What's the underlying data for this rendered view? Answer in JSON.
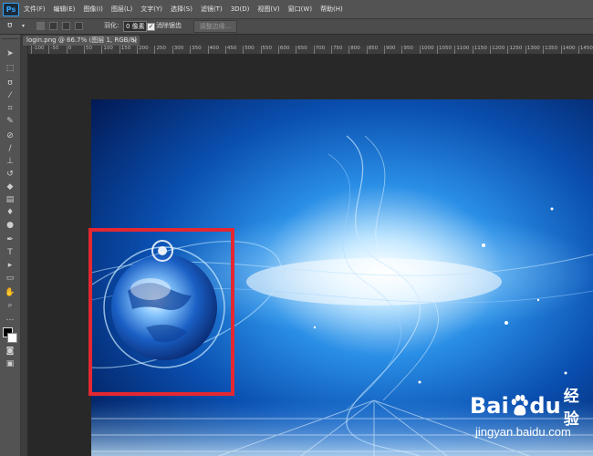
{
  "app": {
    "logo": "Ps",
    "menu": [
      "文件(F)",
      "编辑(E)",
      "图像(I)",
      "图层(L)",
      "文字(Y)",
      "选择(S)",
      "滤镜(T)",
      "3D(D)",
      "视图(V)",
      "窗口(W)",
      "帮助(H)"
    ]
  },
  "options": {
    "feather_label": "羽化:",
    "feather_value": "0 像素",
    "anti_alias_label": "消除锯齿",
    "refine_edge_label": "调整边缘..."
  },
  "document": {
    "tab_label": "login.png @ 66.7% (图层 1, RGB/8)",
    "close_glyph": "×"
  },
  "ruler": {
    "labels": [
      "-100",
      "-50",
      "0",
      "50",
      "100",
      "150",
      "200",
      "250",
      "300",
      "350",
      "400",
      "450",
      "500",
      "550",
      "600",
      "650",
      "700",
      "750",
      "800",
      "850",
      "900",
      "950",
      "1000",
      "1050",
      "1100",
      "1150",
      "1200",
      "1250",
      "1300",
      "1350",
      "1400",
      "1450"
    ]
  },
  "tools": [
    "move-tool",
    "marquee-tool",
    "lasso-tool",
    "quick-selection-tool",
    "crop-tool",
    "eyedropper-tool",
    "healing-brush-tool",
    "brush-tool",
    "clone-stamp-tool",
    "history-brush-tool",
    "eraser-tool",
    "gradient-tool",
    "blur-tool",
    "dodge-tool",
    "pen-tool",
    "type-tool",
    "path-selection-tool",
    "shape-tool",
    "hand-tool",
    "zoom-tool",
    "edit-toolbar-tool",
    "quick-mask-tool",
    "screen-mode-tool"
  ],
  "colors": {
    "foreground": "#000000",
    "background": "#ffffff",
    "highlight": "#e32832"
  },
  "watermark": {
    "bai": "Bai",
    "du": "du",
    "jingyan": "经验",
    "url": "jingyan.baidu.com"
  }
}
